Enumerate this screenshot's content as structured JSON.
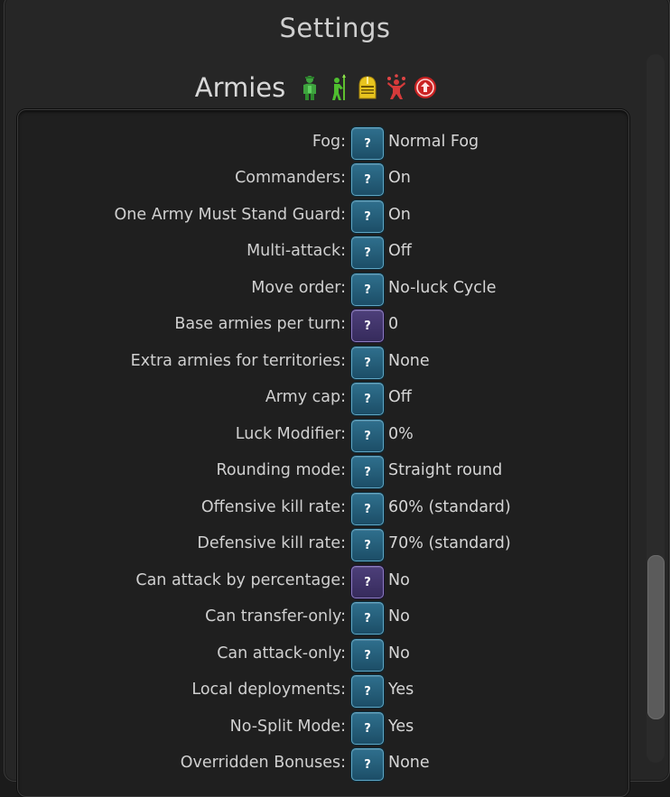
{
  "window": {
    "title": "Settings"
  },
  "section": {
    "title": "Armies",
    "icons": [
      "commander-icon",
      "soldier-spear-icon",
      "helmet-icon",
      "juggler-icon",
      "red-circle-arrow-icon"
    ]
  },
  "help_glyph": "?",
  "settings": [
    {
      "label": "Fog:",
      "value": "Normal Fog",
      "help": "blue"
    },
    {
      "label": "Commanders:",
      "value": "On",
      "help": "blue"
    },
    {
      "label": "One Army Must Stand Guard:",
      "value": "On",
      "help": "blue"
    },
    {
      "label": "Multi-attack:",
      "value": "Off",
      "help": "blue"
    },
    {
      "label": "Move order:",
      "value": "No-luck Cycle",
      "help": "blue"
    },
    {
      "label": "Base armies per turn:",
      "value": "0",
      "help": "purple"
    },
    {
      "label": "Extra armies for territories:",
      "value": "None",
      "help": "blue"
    },
    {
      "label": "Army cap:",
      "value": "Off",
      "help": "blue"
    },
    {
      "label": "Luck Modifier:",
      "value": "0%",
      "help": "blue"
    },
    {
      "label": "Rounding mode:",
      "value": "Straight round",
      "help": "blue"
    },
    {
      "label": "Offensive kill rate:",
      "value": "60% (standard)",
      "help": "blue"
    },
    {
      "label": "Defensive kill rate:",
      "value": "70% (standard)",
      "help": "blue"
    },
    {
      "label": "Can attack by percentage:",
      "value": "No",
      "help": "purple"
    },
    {
      "label": "Can transfer-only:",
      "value": "No",
      "help": "blue"
    },
    {
      "label": "Can attack-only:",
      "value": "No",
      "help": "blue"
    },
    {
      "label": "Local deployments:",
      "value": "Yes",
      "help": "blue"
    },
    {
      "label": "No-Split Mode:",
      "value": "Yes",
      "help": "blue"
    },
    {
      "label": "Overridden Bonuses:",
      "value": "None",
      "help": "blue"
    }
  ]
}
